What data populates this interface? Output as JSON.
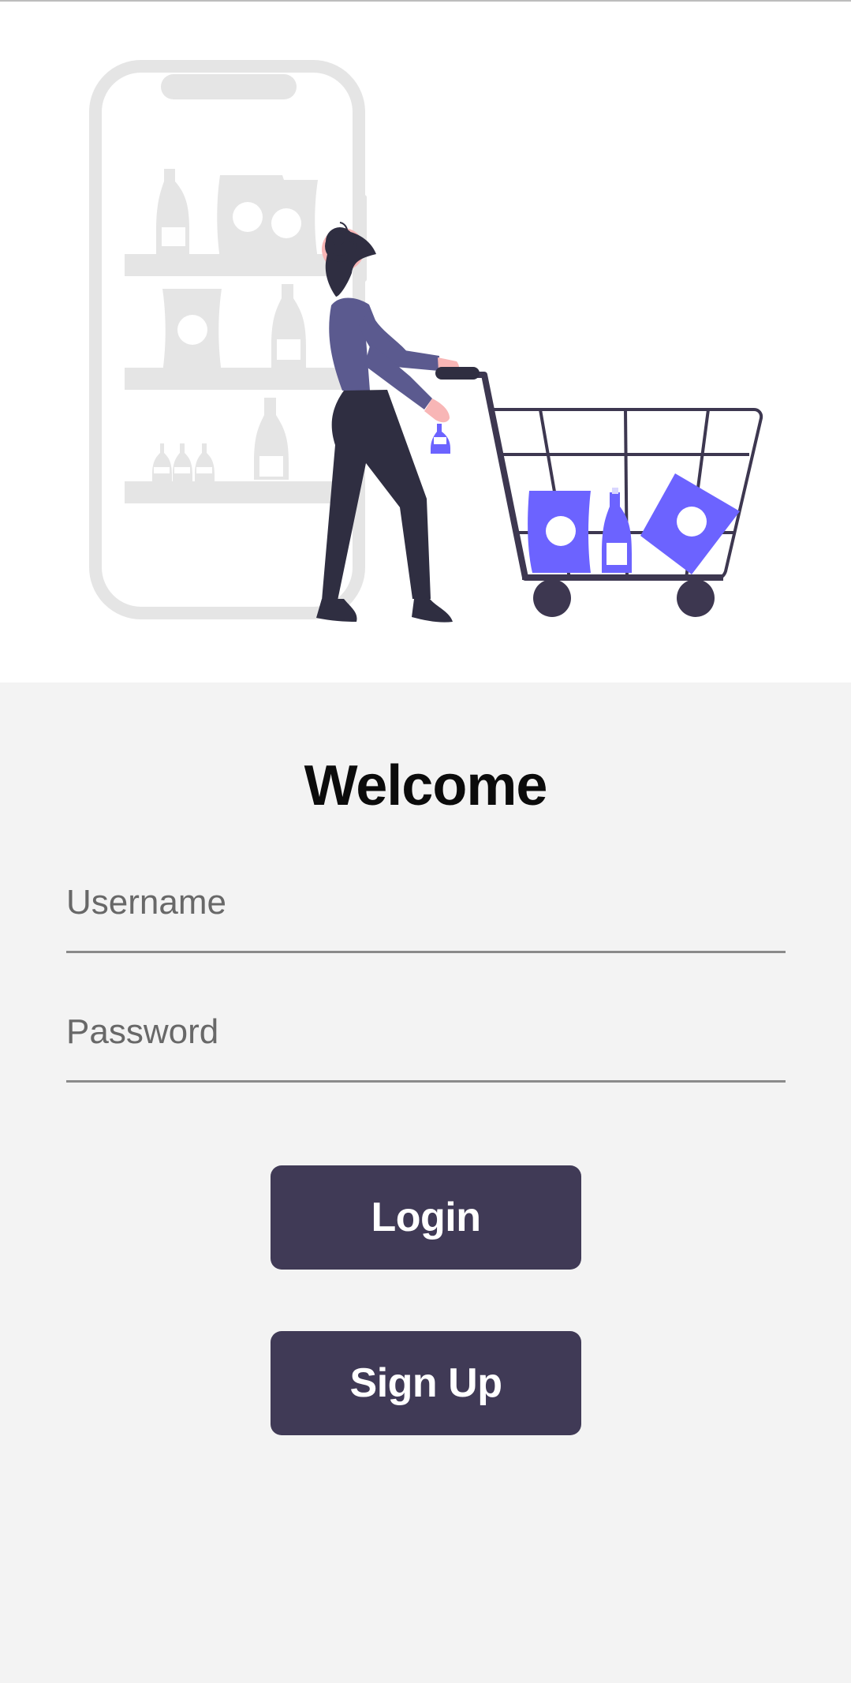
{
  "page": {
    "title": "Welcome"
  },
  "form": {
    "username": {
      "placeholder": "Username",
      "value": ""
    },
    "password": {
      "placeholder": "Password",
      "value": ""
    }
  },
  "actions": {
    "login_label": "Login",
    "signup_label": "Sign Up"
  },
  "hero": {
    "illustration": "shopping-cart-illustration"
  },
  "colors": {
    "hero_background": "#ffffff",
    "page_background": "#f3f3f3",
    "button_background": "#403a56",
    "button_text": "#ffffff",
    "accent_purple": "#6c63ff",
    "illustration_gray": "#e5e5e5"
  }
}
